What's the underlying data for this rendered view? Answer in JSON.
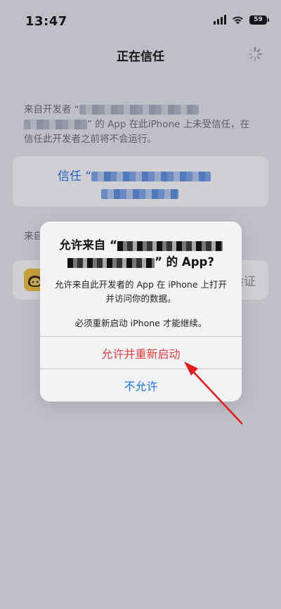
{
  "status_bar": {
    "time": "13:47",
    "battery": "59"
  },
  "nav": {
    "title": "正在信任"
  },
  "background": {
    "description_prefix": "来自开发者 “",
    "description_suffix": "” 的 App 在此iPhone 上未受信任，在信任此开发者之前将不会运行。",
    "trust_label": "信任 “",
    "second_description_prefix": "来自",
    "app_row_right": "验证"
  },
  "alert": {
    "title_prefix": "允许来自 “",
    "title_suffix": "” 的 App?",
    "message_1": "允许来自此开发者的 App 在 iPhone 上打开并访问你的数据。",
    "message_2": "必须重新启动 iPhone 才能继续。",
    "allow_button": "允许并重新启动",
    "deny_button": "不允许"
  },
  "colors": {
    "accent_blue": "#1a73e8",
    "destructive_red": "#e0403d",
    "annotation_red": "#e21d1d",
    "app_icon_yellow": "#f2c43b"
  }
}
